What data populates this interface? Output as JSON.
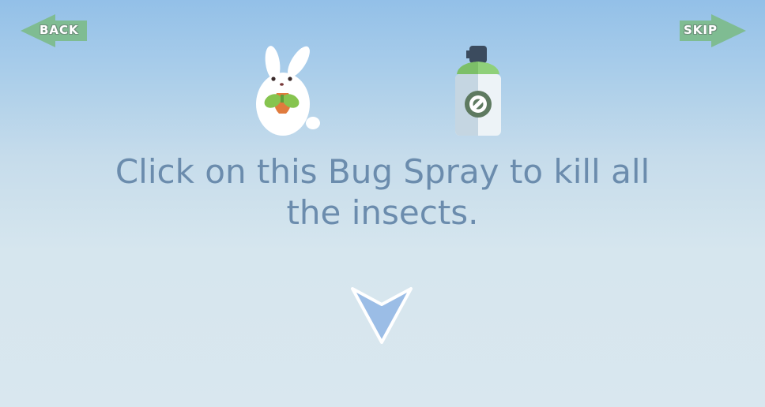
{
  "nav": {
    "back_label": "BACK",
    "skip_label": "SKIP"
  },
  "instruction": {
    "text": "Click on this Bug Spray to kill all the insects."
  },
  "icons": {
    "character": "rabbit-holding-carrot-icon",
    "item": "bug-spray-can-icon",
    "pointer": "down-arrow-icon"
  },
  "colors": {
    "nav_arrow": "#7fbc92",
    "text": "#6b8cad",
    "pointer_fill": "#9bbde6",
    "spray_cap": "#8fd07a"
  }
}
